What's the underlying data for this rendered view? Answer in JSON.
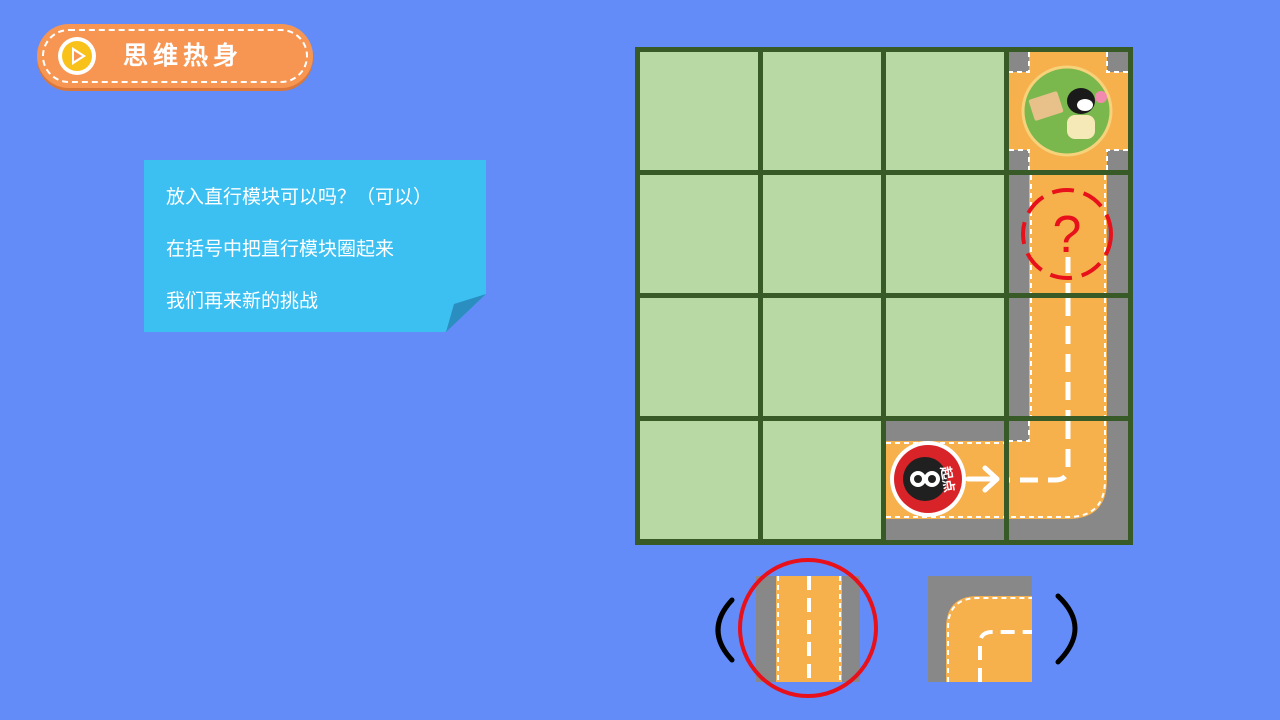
{
  "header": {
    "title": "思维热身",
    "play_icon": "play-icon"
  },
  "note": {
    "lines": [
      "放入直行模块可以吗？（可以）",
      "在括号中把直行模块圈起来",
      "我们再来新的挑战"
    ]
  },
  "board": {
    "rows": 4,
    "cols": 4,
    "goal_icon": "character-goal-icon",
    "start_label": "起点",
    "question_mark": "?",
    "arrow_icon": "arrow-right-icon"
  },
  "choices": {
    "selected": "straight-tile",
    "options": [
      "straight-tile",
      "curve-tile"
    ]
  },
  "colors": {
    "background": "#648cf8",
    "grass": "#b8d8a4",
    "grid": "#385a27",
    "road": "#f6b04c",
    "road_edge": "#888888",
    "highlight": "#e8101a",
    "note": "#3cc0f2",
    "title": "#f79653"
  }
}
